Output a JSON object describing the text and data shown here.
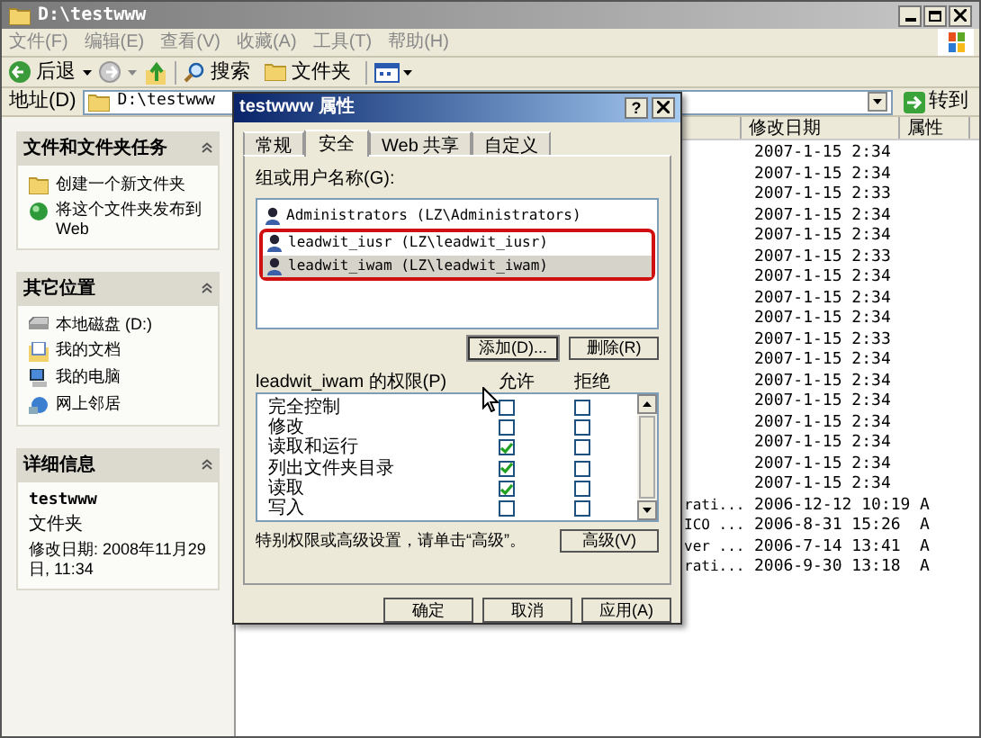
{
  "window": {
    "title": "D:\\testwww"
  },
  "menu": [
    "文件(F)",
    "编辑(E)",
    "查看(V)",
    "收藏(A)",
    "工具(T)",
    "帮助(H)"
  ],
  "toolbar": {
    "back": "后退",
    "search": "搜索",
    "folders": "文件夹"
  },
  "address": {
    "label": "地址(D)",
    "value": "D:\\testwww",
    "go": "转到"
  },
  "tasks": [
    {
      "title": "文件和文件夹任务",
      "items": [
        {
          "kind": "newfolder",
          "label": "创建一个新文件夹"
        },
        {
          "kind": "publish",
          "label": "将这个文件夹发布到 Web"
        }
      ]
    },
    {
      "title": "其它位置",
      "items": [
        {
          "kind": "disk",
          "label": "本地磁盘 (D:)"
        },
        {
          "kind": "docs",
          "label": "我的文档"
        },
        {
          "kind": "computer",
          "label": "我的电脑"
        },
        {
          "kind": "network",
          "label": "网上邻居"
        }
      ]
    },
    {
      "title": "详细信息",
      "details": {
        "name": "testwww",
        "type": "文件夹",
        "modified": "修改日期: 2008年11月29日, 11:34"
      }
    }
  ],
  "files": {
    "columns": [
      "修改日期",
      "属性"
    ],
    "rows": [
      {
        "modified": "2007-1-15 2:34"
      },
      {
        "modified": "2007-1-15 2:34"
      },
      {
        "modified": "2007-1-15 2:33"
      },
      {
        "modified": "2007-1-15 2:34"
      },
      {
        "modified": "2007-1-15 2:34"
      },
      {
        "modified": "2007-1-15 2:33"
      },
      {
        "modified": "2007-1-15 2:34"
      },
      {
        "modified": "2007-1-15 2:34"
      },
      {
        "modified": "2007-1-15 2:34"
      },
      {
        "modified": "2007-1-15 2:33"
      },
      {
        "modified": "2007-1-15 2:34"
      },
      {
        "modified": "2007-1-15 2:34"
      },
      {
        "modified": "2007-1-15 2:34"
      },
      {
        "modified": "2007-1-15 2:34"
      },
      {
        "modified": "2007-1-15 2:34"
      },
      {
        "modified": "2007-1-15 2:34"
      },
      {
        "modified": "2007-1-15 2:34"
      },
      {
        "name": "rati...",
        "modified": "2006-12-12 10:19",
        "attributes": "A"
      },
      {
        "name": "ICO ...",
        "modified": "2006-8-31 15:26",
        "attributes": "A"
      },
      {
        "name": "ver ...",
        "modified": "2006-7-14 13:41",
        "attributes": "A"
      },
      {
        "name": "rati...",
        "modified": "2006-9-30 13:18",
        "attributes": "A"
      }
    ]
  },
  "dialog": {
    "title": "testwww 属性",
    "help": "?",
    "tabs": [
      {
        "label": "常规",
        "selected": false
      },
      {
        "label": "安全",
        "selected": true
      },
      {
        "label": "Web 共享",
        "selected": false
      },
      {
        "label": "自定义",
        "selected": false
      }
    ],
    "users_label": "组或用户名称(G):",
    "users": [
      {
        "name": "Administrators (LZ\\Administrators)",
        "selected": false,
        "highlighted": false
      },
      {
        "name": "leadwit_iusr (LZ\\leadwit_iusr)",
        "selected": false,
        "highlighted": true
      },
      {
        "name": "leadwit_iwam (LZ\\leadwit_iwam)",
        "selected": true,
        "highlighted": true
      }
    ],
    "add": "添加(D)...",
    "remove": "删除(R)",
    "perm_label": "leadwit_iwam 的权限(P)",
    "allow_label": "允许",
    "deny_label": "拒绝",
    "permissions": [
      {
        "name": "完全控制",
        "allow": false,
        "deny": false
      },
      {
        "name": "修改",
        "allow": false,
        "deny": false
      },
      {
        "name": "读取和运行",
        "allow": true,
        "deny": false
      },
      {
        "name": "列出文件夹目录",
        "allow": true,
        "deny": false
      },
      {
        "name": "读取",
        "allow": true,
        "deny": false
      },
      {
        "name": "写入",
        "allow": false,
        "deny": false
      }
    ],
    "advanced_hint": "特别权限或高级设置，请单击“高级”。",
    "advanced": "高级(V)",
    "buttons": [
      "确定",
      "取消",
      "应用(A)"
    ]
  }
}
